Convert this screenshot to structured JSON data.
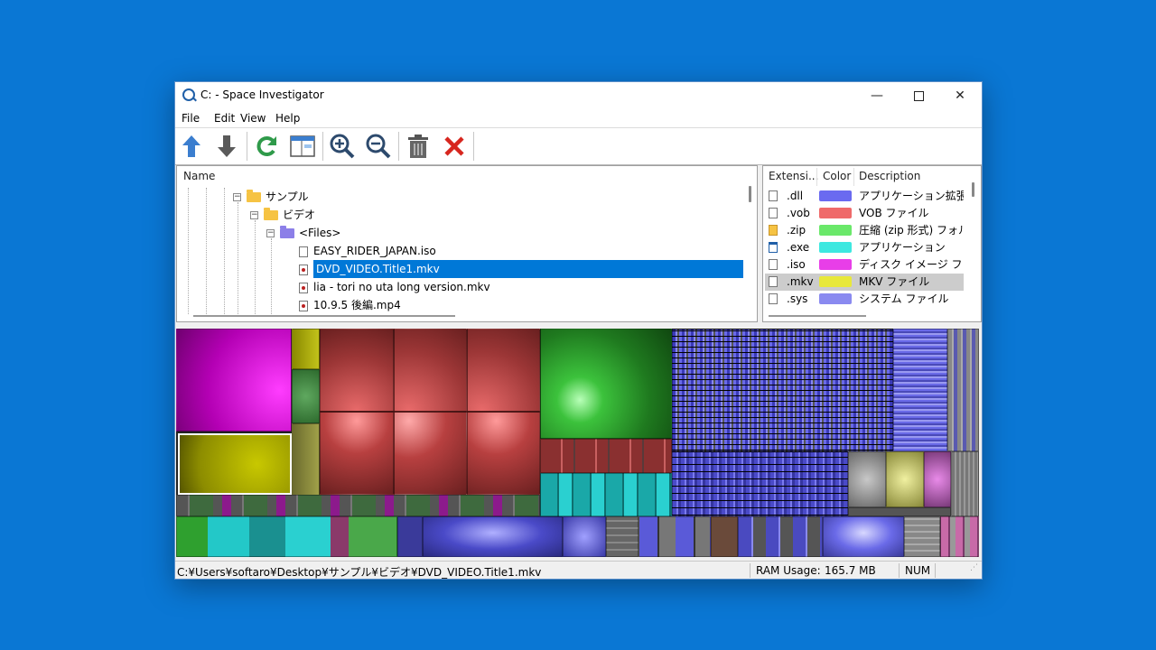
{
  "window": {
    "title": "C: - Space Investigator"
  },
  "menu": [
    "File",
    "Edit",
    "View",
    "Help"
  ],
  "toolbar": {
    "icons": [
      "arrow-up-icon",
      "arrow-down-icon",
      "refresh-icon",
      "layout-icon",
      "zoom-in-icon",
      "zoom-out-icon",
      "trash-icon",
      "delete-x-icon"
    ]
  },
  "tree": {
    "header": "Name",
    "rows": [
      {
        "label": "サンプル",
        "kind": "folder",
        "expander": "⊟"
      },
      {
        "label": "ビデオ",
        "kind": "folder",
        "expander": "⊟"
      },
      {
        "label": "<Files>",
        "kind": "folder-purple",
        "expander": "⊟"
      },
      {
        "label": "EASY_RIDER_JAPAN.iso",
        "kind": "file"
      },
      {
        "label": "DVD_VIDEO.Title1.mkv",
        "kind": "video",
        "selected": true
      },
      {
        "label": "lia - tori no uta long version.mkv",
        "kind": "video"
      },
      {
        "label": "10.9.5 後編.mp4",
        "kind": "video"
      }
    ]
  },
  "extensions": {
    "headers": {
      "ext": "Extensi...",
      "color": "Color",
      "desc": "Description"
    },
    "rows": [
      {
        "ext": ".dll",
        "color": "#6a6af0",
        "desc": "アプリケーション拡張"
      },
      {
        "ext": ".vob",
        "color": "#ef6a6a",
        "desc": "VOB ファイル"
      },
      {
        "ext": ".zip",
        "color": "#6ae86a",
        "desc": "圧縮 (zip 形式) フォルダー"
      },
      {
        "ext": ".exe",
        "color": "#3ee8e0",
        "desc": "アプリケーション"
      },
      {
        "ext": ".iso",
        "color": "#e83ee8",
        "desc": "ディスク イメージ ファイル"
      },
      {
        "ext": ".mkv",
        "color": "#e8e83a",
        "desc": "MKV ファイル",
        "selected": true
      },
      {
        "ext": ".sys",
        "color": "#8a8af0",
        "desc": "システム ファイル"
      }
    ]
  },
  "status": {
    "path": "C:¥Users¥softaro¥Desktop¥サンプル¥ビデオ¥DVD_VIDEO.Title1.mkv",
    "ram_label": "RAM Usage:",
    "ram_value": "165.7 MB",
    "num": "NUM"
  }
}
